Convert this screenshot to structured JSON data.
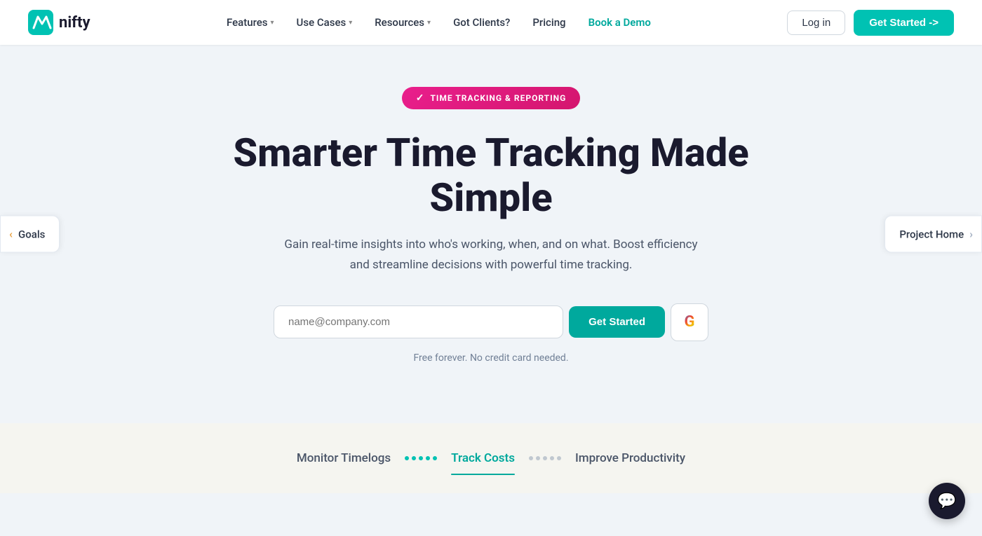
{
  "logo": {
    "text": "nifty"
  },
  "nav": {
    "links": [
      {
        "label": "Features",
        "has_dropdown": true
      },
      {
        "label": "Use Cases",
        "has_dropdown": true
      },
      {
        "label": "Resources",
        "has_dropdown": true
      },
      {
        "label": "Got Clients?",
        "has_dropdown": false
      },
      {
        "label": "Pricing",
        "has_dropdown": false
      },
      {
        "label": "Book a Demo",
        "has_dropdown": false,
        "special": true
      }
    ],
    "login_label": "Log in",
    "get_started_label": "Get Started ->"
  },
  "hero": {
    "badge_text": "TIME TRACKING & REPORTING",
    "title": "Smarter Time Tracking Made Simple",
    "subtitle": "Gain real-time insights into who's working, when, and on what. Boost efficiency and streamline decisions with powerful time tracking.",
    "email_placeholder": "name@company.com",
    "get_started_label": "Get Started",
    "note": "Free forever. No credit card needed."
  },
  "side_nav": {
    "left": {
      "label": "Goals"
    },
    "right": {
      "label": "Project Home"
    }
  },
  "tabs": [
    {
      "label": "Monitor Timelogs",
      "active": false,
      "dots_color": "teal",
      "dot_count": 5
    },
    {
      "label": "Track Costs",
      "active": true,
      "dots_color": "gray",
      "dot_count": 5
    },
    {
      "label": "Improve Productivity",
      "active": false
    }
  ],
  "chat": {
    "icon": "💬"
  }
}
